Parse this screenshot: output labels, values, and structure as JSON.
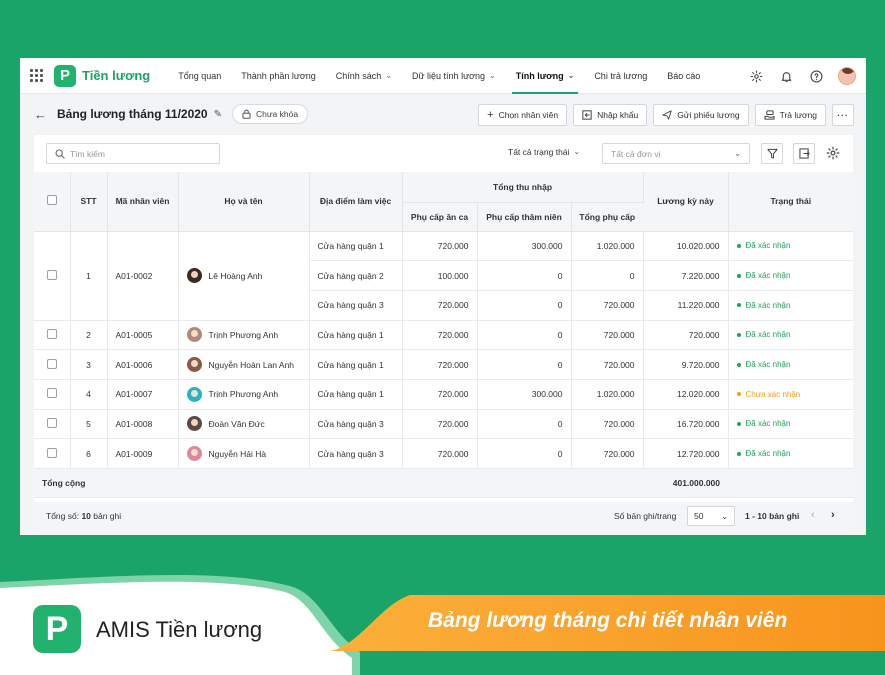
{
  "app": {
    "brand": "Tiền lương",
    "logo_letter": "P"
  },
  "nav": [
    {
      "label": "Tổng quan",
      "dropdown": false,
      "active": false
    },
    {
      "label": "Thành phần lương",
      "dropdown": false,
      "active": false
    },
    {
      "label": "Chính sách",
      "dropdown": true,
      "active": false
    },
    {
      "label": "Dữ liệu tính lương",
      "dropdown": true,
      "active": false
    },
    {
      "label": "Tính lương",
      "dropdown": true,
      "active": true
    },
    {
      "label": "Chi trả lương",
      "dropdown": false,
      "active": false
    },
    {
      "label": "Báo cáo",
      "dropdown": false,
      "active": false
    }
  ],
  "page": {
    "title": "Bảng lương tháng 11/2020",
    "lock_label": "Chưa khóa"
  },
  "actions": {
    "select_employee": "Chọn nhân viên",
    "import": "Nhập khẩu",
    "send_slip": "Gửi phiếu lương",
    "pay": "Trả lương",
    "more": "···"
  },
  "filters": {
    "search_placeholder": "Tìm kiếm",
    "status": "Tất cả trạng thái",
    "unit": "Tất cả đơn vị"
  },
  "table": {
    "headers": {
      "stt": "STT",
      "code": "Mã nhân viên",
      "name": "Họ và tên",
      "location": "Địa điểm làm việc",
      "income_group": "Tổng thu nhập",
      "meal": "Phụ cấp ăn ca",
      "seniority": "Phụ cấp thâm niên",
      "total_allow": "Tổng phụ cấp",
      "salary": "Lương kỳ này",
      "status": "Trạng thái"
    },
    "first_group": {
      "stt": "1",
      "code": "A01-0002",
      "name": "Lê Hoàng Anh",
      "avatar_color": "#3a2a22",
      "rows": [
        {
          "location": "Cửa hàng quận 1",
          "meal": "720.000",
          "seniority": "300.000",
          "total": "1.020.000",
          "salary": "10.020.000",
          "status": "Đã xác nhận"
        },
        {
          "location": "Cửa hàng quận 2",
          "meal": "100.000",
          "seniority": "0",
          "total": "0",
          "salary": "7.220.000",
          "status": "Đã xác nhận"
        },
        {
          "location": "Cửa hàng quận 3",
          "meal": "720.000",
          "seniority": "0",
          "total": "720.000",
          "salary": "11.220.000",
          "status": "Đã xác nhận"
        }
      ]
    },
    "rows": [
      {
        "stt": "2",
        "code": "A01-0005",
        "name": "Trịnh Phương Anh",
        "avatar_color": "#b08a78",
        "location": "Cửa hàng quận 1",
        "meal": "720.000",
        "seniority": "0",
        "total": "720.000",
        "salary": "720.000",
        "status": "Đã xác nhận",
        "status_color": "#21a35b"
      },
      {
        "stt": "3",
        "code": "A01-0006",
        "name": "Nguyễn Hoàn Lan Anh",
        "avatar_color": "#8a5a48",
        "location": "Cửa hàng quận 1",
        "meal": "720.000",
        "seniority": "0",
        "total": "720.000",
        "salary": "9.720.000",
        "status": "Đã xác nhận",
        "status_color": "#21a35b"
      },
      {
        "stt": "4",
        "code": "A01-0007",
        "name": "Trịnh Phương Anh",
        "avatar_color": "#2bb3c0",
        "location": "Cửa hàng quận 1",
        "meal": "720.000",
        "seniority": "300.000",
        "total": "1.020.000",
        "salary": "12.020.000",
        "status": "Chưa xác nhận",
        "status_color": "#f59e0b"
      },
      {
        "stt": "5",
        "code": "A01-0008",
        "name": "Đoàn Văn Đức",
        "avatar_color": "#5a4a44",
        "location": "Cửa hàng quận 3",
        "meal": "720.000",
        "seniority": "0",
        "total": "720.000",
        "salary": "16.720.000",
        "status": "Đã xác nhận",
        "status_color": "#21a35b"
      },
      {
        "stt": "6",
        "code": "A01-0009",
        "name": "Nguyễn Hải Hà",
        "avatar_color": "#d98a9a",
        "location": "Cửa hàng quận 3",
        "meal": "720.000",
        "seniority": "0",
        "total": "720.000",
        "salary": "12.720.000",
        "status": "Đã xác nhận",
        "status_color": "#21a35b"
      }
    ],
    "total_label": "Tổng cộng",
    "total_value": "401.000.000"
  },
  "pager": {
    "total_prefix": "Tổng số: ",
    "total_count": "10",
    "total_suffix": " bản ghi",
    "per_page_label": "Số bản ghi/trang",
    "per_page": "50",
    "range": "1 - 10 bản ghi"
  },
  "banner": {
    "product": "AMIS Tiền lương",
    "slogan": "Bảng lương tháng chi tiết nhân viên",
    "logo_letter": "P"
  },
  "colors": {
    "brand_green": "#1aa46a",
    "confirmed": "#21a35b",
    "pending": "#f59e0b",
    "orange": "#f7941d"
  }
}
